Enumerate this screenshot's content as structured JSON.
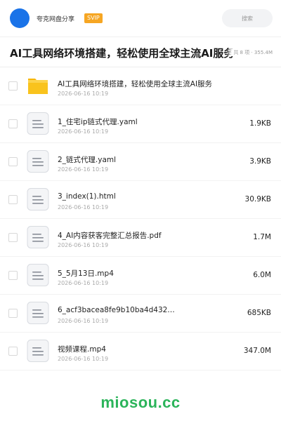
{
  "header": {
    "user_name": "夸克网盘分享",
    "badge": "SVIP",
    "search_placeholder": "搜索"
  },
  "folder": {
    "title": "AI工具网络环境搭建，轻松使用全球主流AI服务",
    "meta": "共 8 项 · 355.4M"
  },
  "files": [
    {
      "type": "folder",
      "name": "AI工具网络环境搭建，轻松使用全球主流AI服务",
      "date": "2026-06-16 10:19",
      "size": ""
    },
    {
      "type": "doc",
      "name": "1_住宅ip链式代理.yaml",
      "date": "2026-06-16 10:19",
      "size": "1.9KB"
    },
    {
      "type": "doc",
      "name": "2_链式代理.yaml",
      "date": "2026-06-16 10:19",
      "size": "3.9KB"
    },
    {
      "type": "doc",
      "name": "3_index(1).html",
      "date": "2026-06-16 10:19",
      "size": "30.9KB"
    },
    {
      "type": "doc",
      "name": "4_AI内容获客完整汇总报告.pdf",
      "date": "2026-06-16 10:19",
      "size": "1.7M"
    },
    {
      "type": "doc",
      "name": "5_5月13日.mp4",
      "date": "2026-06-16 10:19",
      "size": "6.0M"
    },
    {
      "type": "doc",
      "name": "6_acf3bacea8fe9b10ba4d432…",
      "date": "2026-06-16 10:19",
      "size": "685KB"
    },
    {
      "type": "doc",
      "name": "视频课程.mp4",
      "date": "2026-06-16 10:19",
      "size": "347.0M"
    }
  ],
  "footer": {
    "watermark": "miosou.cc"
  },
  "colors": {
    "accent": "#1a73e8",
    "badge": "#f6a623",
    "folder": "#f9c31d",
    "watermark": "#2bb45a"
  },
  "icons": {
    "folder": "folder-icon",
    "doc": "document-icon"
  }
}
